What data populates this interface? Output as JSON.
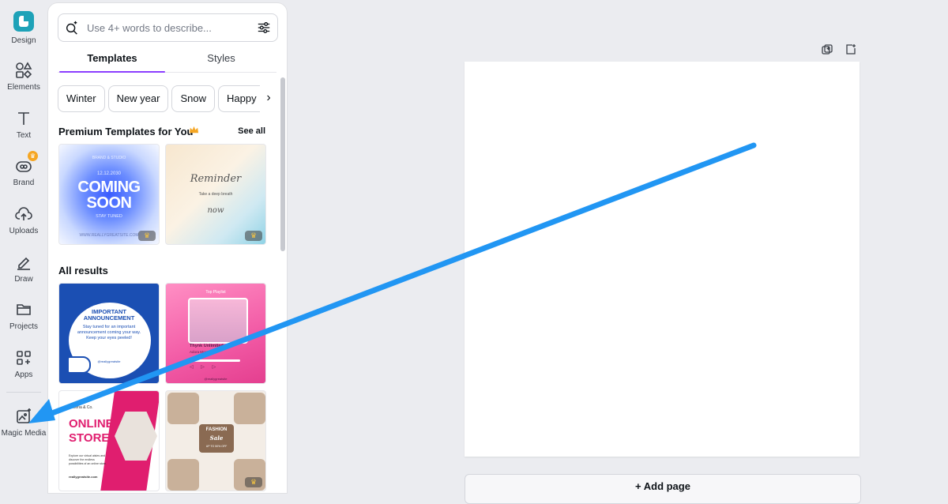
{
  "sidebar": {
    "items": [
      {
        "label": "Design",
        "icon": "design-logo-icon"
      },
      {
        "label": "Elements",
        "icon": "shapes-icon"
      },
      {
        "label": "Text",
        "icon": "text-t-icon"
      },
      {
        "label": "Brand",
        "icon": "brand-icon"
      },
      {
        "label": "Uploads",
        "icon": "cloud-upload-icon"
      },
      {
        "label": "Draw",
        "icon": "pen-icon"
      },
      {
        "label": "Projects",
        "icon": "folder-icon"
      },
      {
        "label": "Apps",
        "icon": "apps-grid-icon"
      },
      {
        "label": "Magic Media",
        "icon": "magic-image-icon"
      }
    ]
  },
  "panel": {
    "search": {
      "placeholder": "Use 4+ words to describe..."
    },
    "tabs": [
      "Templates",
      "Styles"
    ],
    "chips": [
      "Winter",
      "New year",
      "Snow",
      "Happy n"
    ],
    "premium_title": "Premium Templates for You",
    "see_all": "See all",
    "all_results_title": "All results",
    "templates": {
      "coming_soon": {
        "date": "12.12.2030",
        "line1": "COMING",
        "line2": "SOON",
        "tag": "STAY TUNED",
        "top": "BRAND & STUDIO",
        "site": "WWW.REALLYGREATSITE.COM"
      },
      "reminder": {
        "title": "Reminder",
        "sub": "Take a deep breath",
        "word": "now"
      },
      "announcement": {
        "title": "IMPORTANT ANNOUNCEMENT",
        "body": "Stay tuned for an important announcement coming your way. Keep your eyes peeled!",
        "handle": "@reallygreatsite"
      },
      "music": {
        "top": "Top Playlist",
        "name": "Thynk Unlimited",
        "sub": "Adora Montminy",
        "controls": "◁ ▷ ▷",
        "handle": "@reallygreatsite"
      },
      "online_store": {
        "brand": "Liceria & Co.",
        "line1": "ONLINE",
        "line2": "STORE",
        "body": "Explore our virtual aisles and discover the endless possibilities of an online store.",
        "site": "reallygreatsite.com"
      },
      "fashion": {
        "title": "FASHION",
        "script": "Sale",
        "offer": "UP TO 50% OFF"
      }
    }
  },
  "canvas": {
    "add_page_label": "+ Add page",
    "arrow_color": "#2196f3"
  },
  "colors": {
    "accent": "#8b3dff",
    "crown": "#f5a623"
  }
}
